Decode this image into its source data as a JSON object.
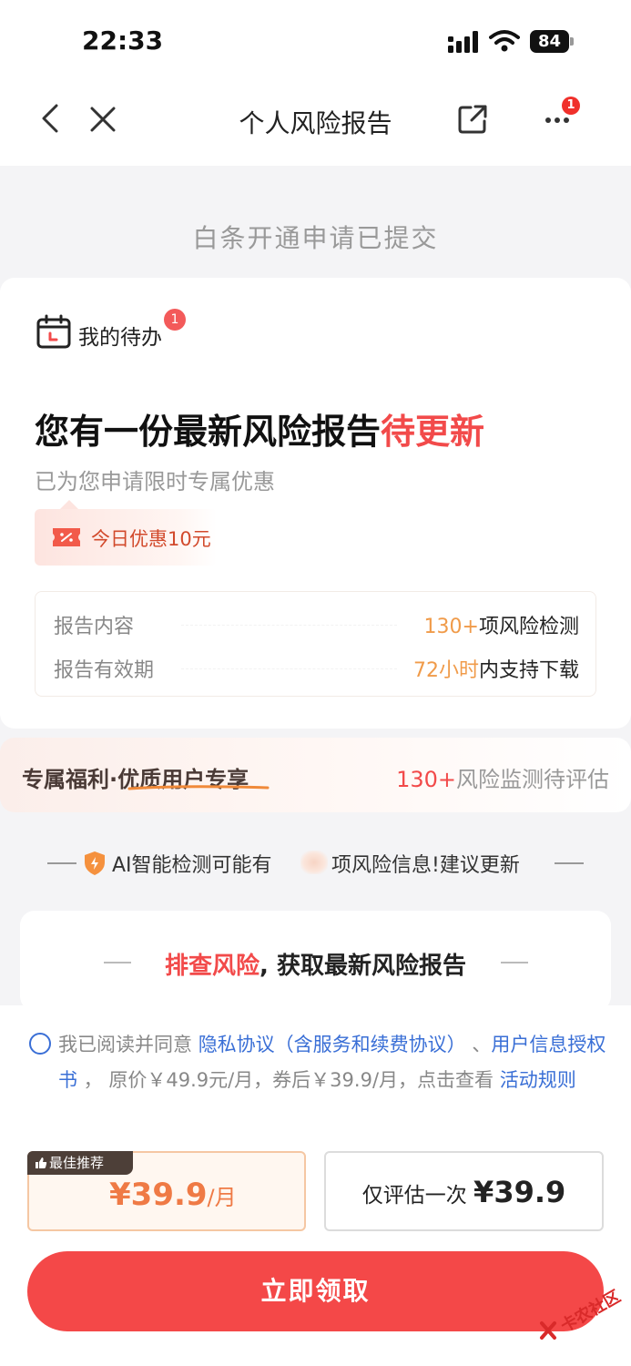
{
  "status_bar": {
    "time": "22:33",
    "battery": "84"
  },
  "nav": {
    "title": "个人风险报告",
    "more_badge": "1"
  },
  "header": {
    "submitted": "白条开通申请已提交"
  },
  "todo": {
    "label": "我的待办",
    "badge": "1",
    "headline_main": "您有一份最新风险报告",
    "headline_highlight": "待更新",
    "subline": "已为您申请限时专属优惠",
    "coupon": "今日优惠10元",
    "info": [
      {
        "label": "报告内容",
        "value_highlight": "130+",
        "value_rest": "项风险检测"
      },
      {
        "label": "报告有效期",
        "value_highlight": "72小时",
        "value_rest": "内支持下载"
      }
    ]
  },
  "welfare": {
    "left": "专属福利·优质用户专享",
    "right_num": "130+",
    "right_text": "风险监测待评估"
  },
  "ai": {
    "text_a": "AI智能检测可能有",
    "text_b": "项风险信息!建议更新"
  },
  "check": {
    "title_red": "排查风险",
    "title_rest": ", 获取最新风险报告"
  },
  "agreement": {
    "prefix": "我已阅读并同意 ",
    "link1": "隐私协议（含服务和续费协议）",
    "sep": " 、",
    "link2": "用户信息授权书",
    "middle": " ， 原价￥49.9元/月，券后￥39.9/月，点击查看 ",
    "link3": "活动规则"
  },
  "plans": {
    "best_tag": "最佳推荐",
    "monthly_price": "¥39.9",
    "monthly_unit": "/月",
    "once_label": "仅评估一次 ",
    "once_price": "¥39.9"
  },
  "cta": {
    "label": "立即领取"
  },
  "watermark": {
    "text": "卡农社区"
  },
  "colors": {
    "accent_red": "#f44848",
    "highlight_orange": "#f09b4a",
    "link_blue": "#3a6fd6"
  }
}
